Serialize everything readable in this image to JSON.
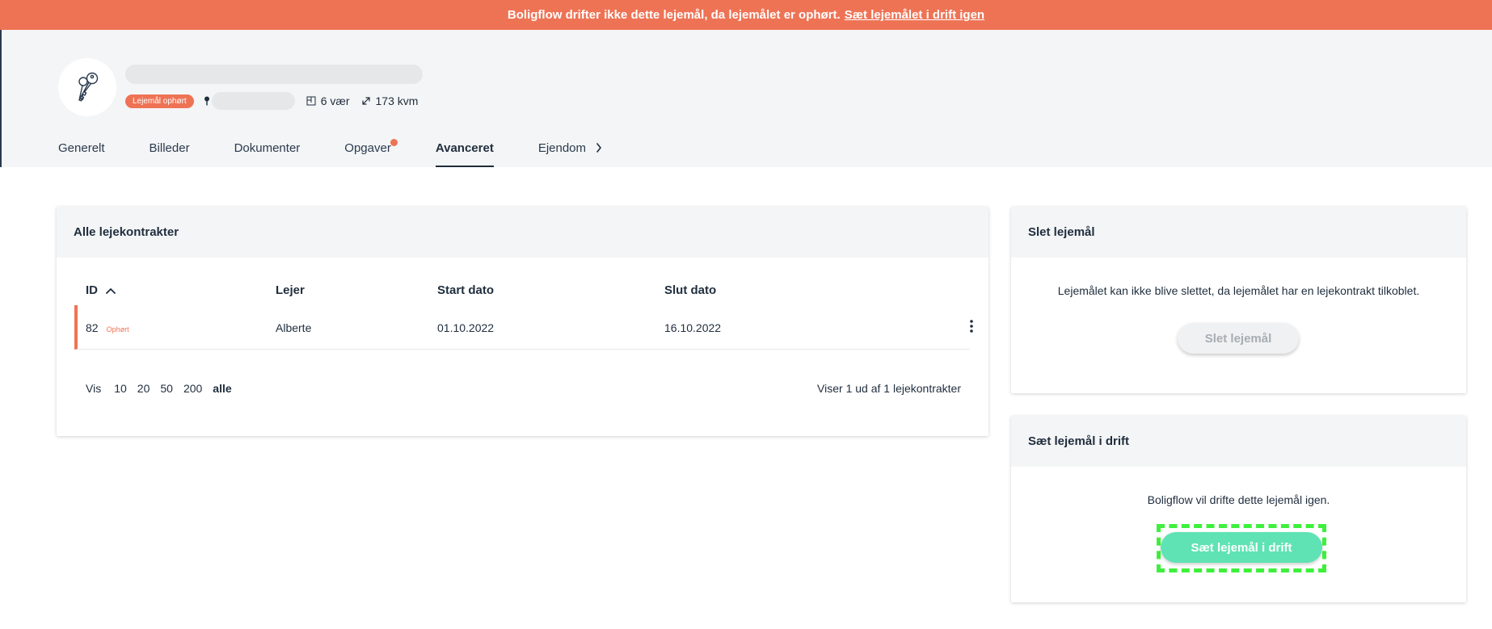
{
  "banner": {
    "message": "Boligflow drifter ikke dette lejemål, da lejemålet er ophørt.",
    "link": "Sæt lejemålet i drift igen"
  },
  "property": {
    "status_badge": "Lejemål ophørt",
    "rooms": "6 vær",
    "area": "173 kvm"
  },
  "tabs": [
    {
      "label": "Generelt"
    },
    {
      "label": "Billeder"
    },
    {
      "label": "Dokumenter"
    },
    {
      "label": "Opgaver"
    },
    {
      "label": "Avanceret"
    },
    {
      "label": "Ejendom"
    }
  ],
  "contracts": {
    "title": "Alle lejekontrakter",
    "columns": [
      "ID",
      "Lejer",
      "Start dato",
      "Slut dato"
    ],
    "rows": [
      {
        "id": "82",
        "status": "Ophørt",
        "tenant": "Alberte",
        "start": "01.10.2022",
        "end": "16.10.2022"
      }
    ],
    "pager": {
      "label": "Vis",
      "options": [
        "10",
        "20",
        "50",
        "200",
        "alle"
      ],
      "selected": "alle"
    },
    "count_text": "Viser 1 ud af 1 lejekontrakter"
  },
  "delete_card": {
    "title": "Slet lejemål",
    "text": "Lejemålet kan ikke blive slettet, da lejemålet har en lejekontrakt tilkoblet.",
    "button": "Slet lejemål"
  },
  "drift_card": {
    "title": "Sæt lejemål i drift",
    "text": "Boligflow vil drifte dette lejemål igen.",
    "button": "Sæt lejemål i drift"
  },
  "colors": {
    "accent_orange": "#ee7355",
    "primary_green": "#5fe3b4",
    "focus_ring": "#3ef03c"
  }
}
